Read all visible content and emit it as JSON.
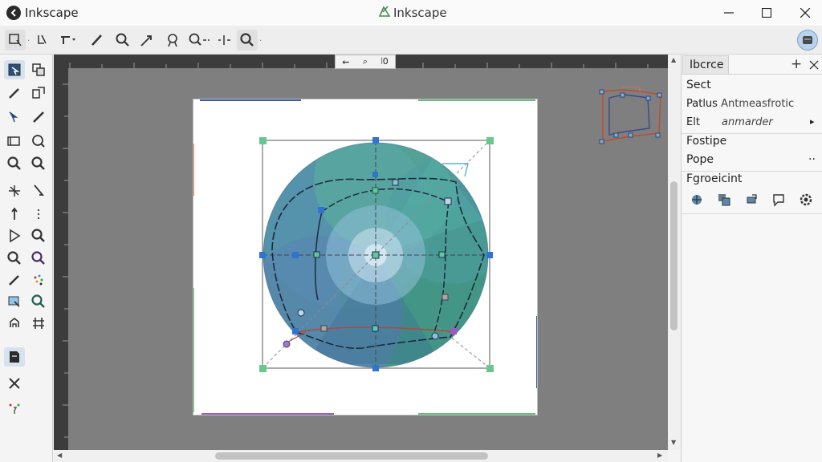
{
  "window": {
    "title_left": "Inkscape",
    "title_center": "Inkscape"
  },
  "canvas": {
    "zoom_controls": [
      "⇜",
      "⌕",
      "⦚0"
    ]
  },
  "dock": {
    "tab_label": "Ibcrce",
    "rows": [
      {
        "label": "Sect"
      },
      {
        "label": "Patlus",
        "sub": "Antmeasfrotic"
      },
      {
        "label": "Elt",
        "sub": "anmarder",
        "arrow": "▸"
      },
      {
        "label": "Fostipe"
      },
      {
        "label": "Pope",
        "extra": "··"
      },
      {
        "label": "Fgroeicint"
      }
    ]
  },
  "icons": {
    "toolbar": [
      "select-tool-icon",
      "node-tool-icon",
      "tweak-tool-icon",
      "pen-tool-icon",
      "zoom-icon",
      "measure-icon",
      "spray-icon",
      "zoom-out-icon",
      "zoom-drawing-icon"
    ],
    "dock": [
      "layers-icon",
      "objects-icon",
      "transform-icon",
      "comment-icon",
      "settings-icon"
    ]
  },
  "colors": {
    "canvas_bg": "#7f7f7f",
    "ruler": "#3c3c3c",
    "selection_handle": "#5fcf8c",
    "node_blue": "#2f74d0",
    "path_orange": "#d07a3a"
  }
}
